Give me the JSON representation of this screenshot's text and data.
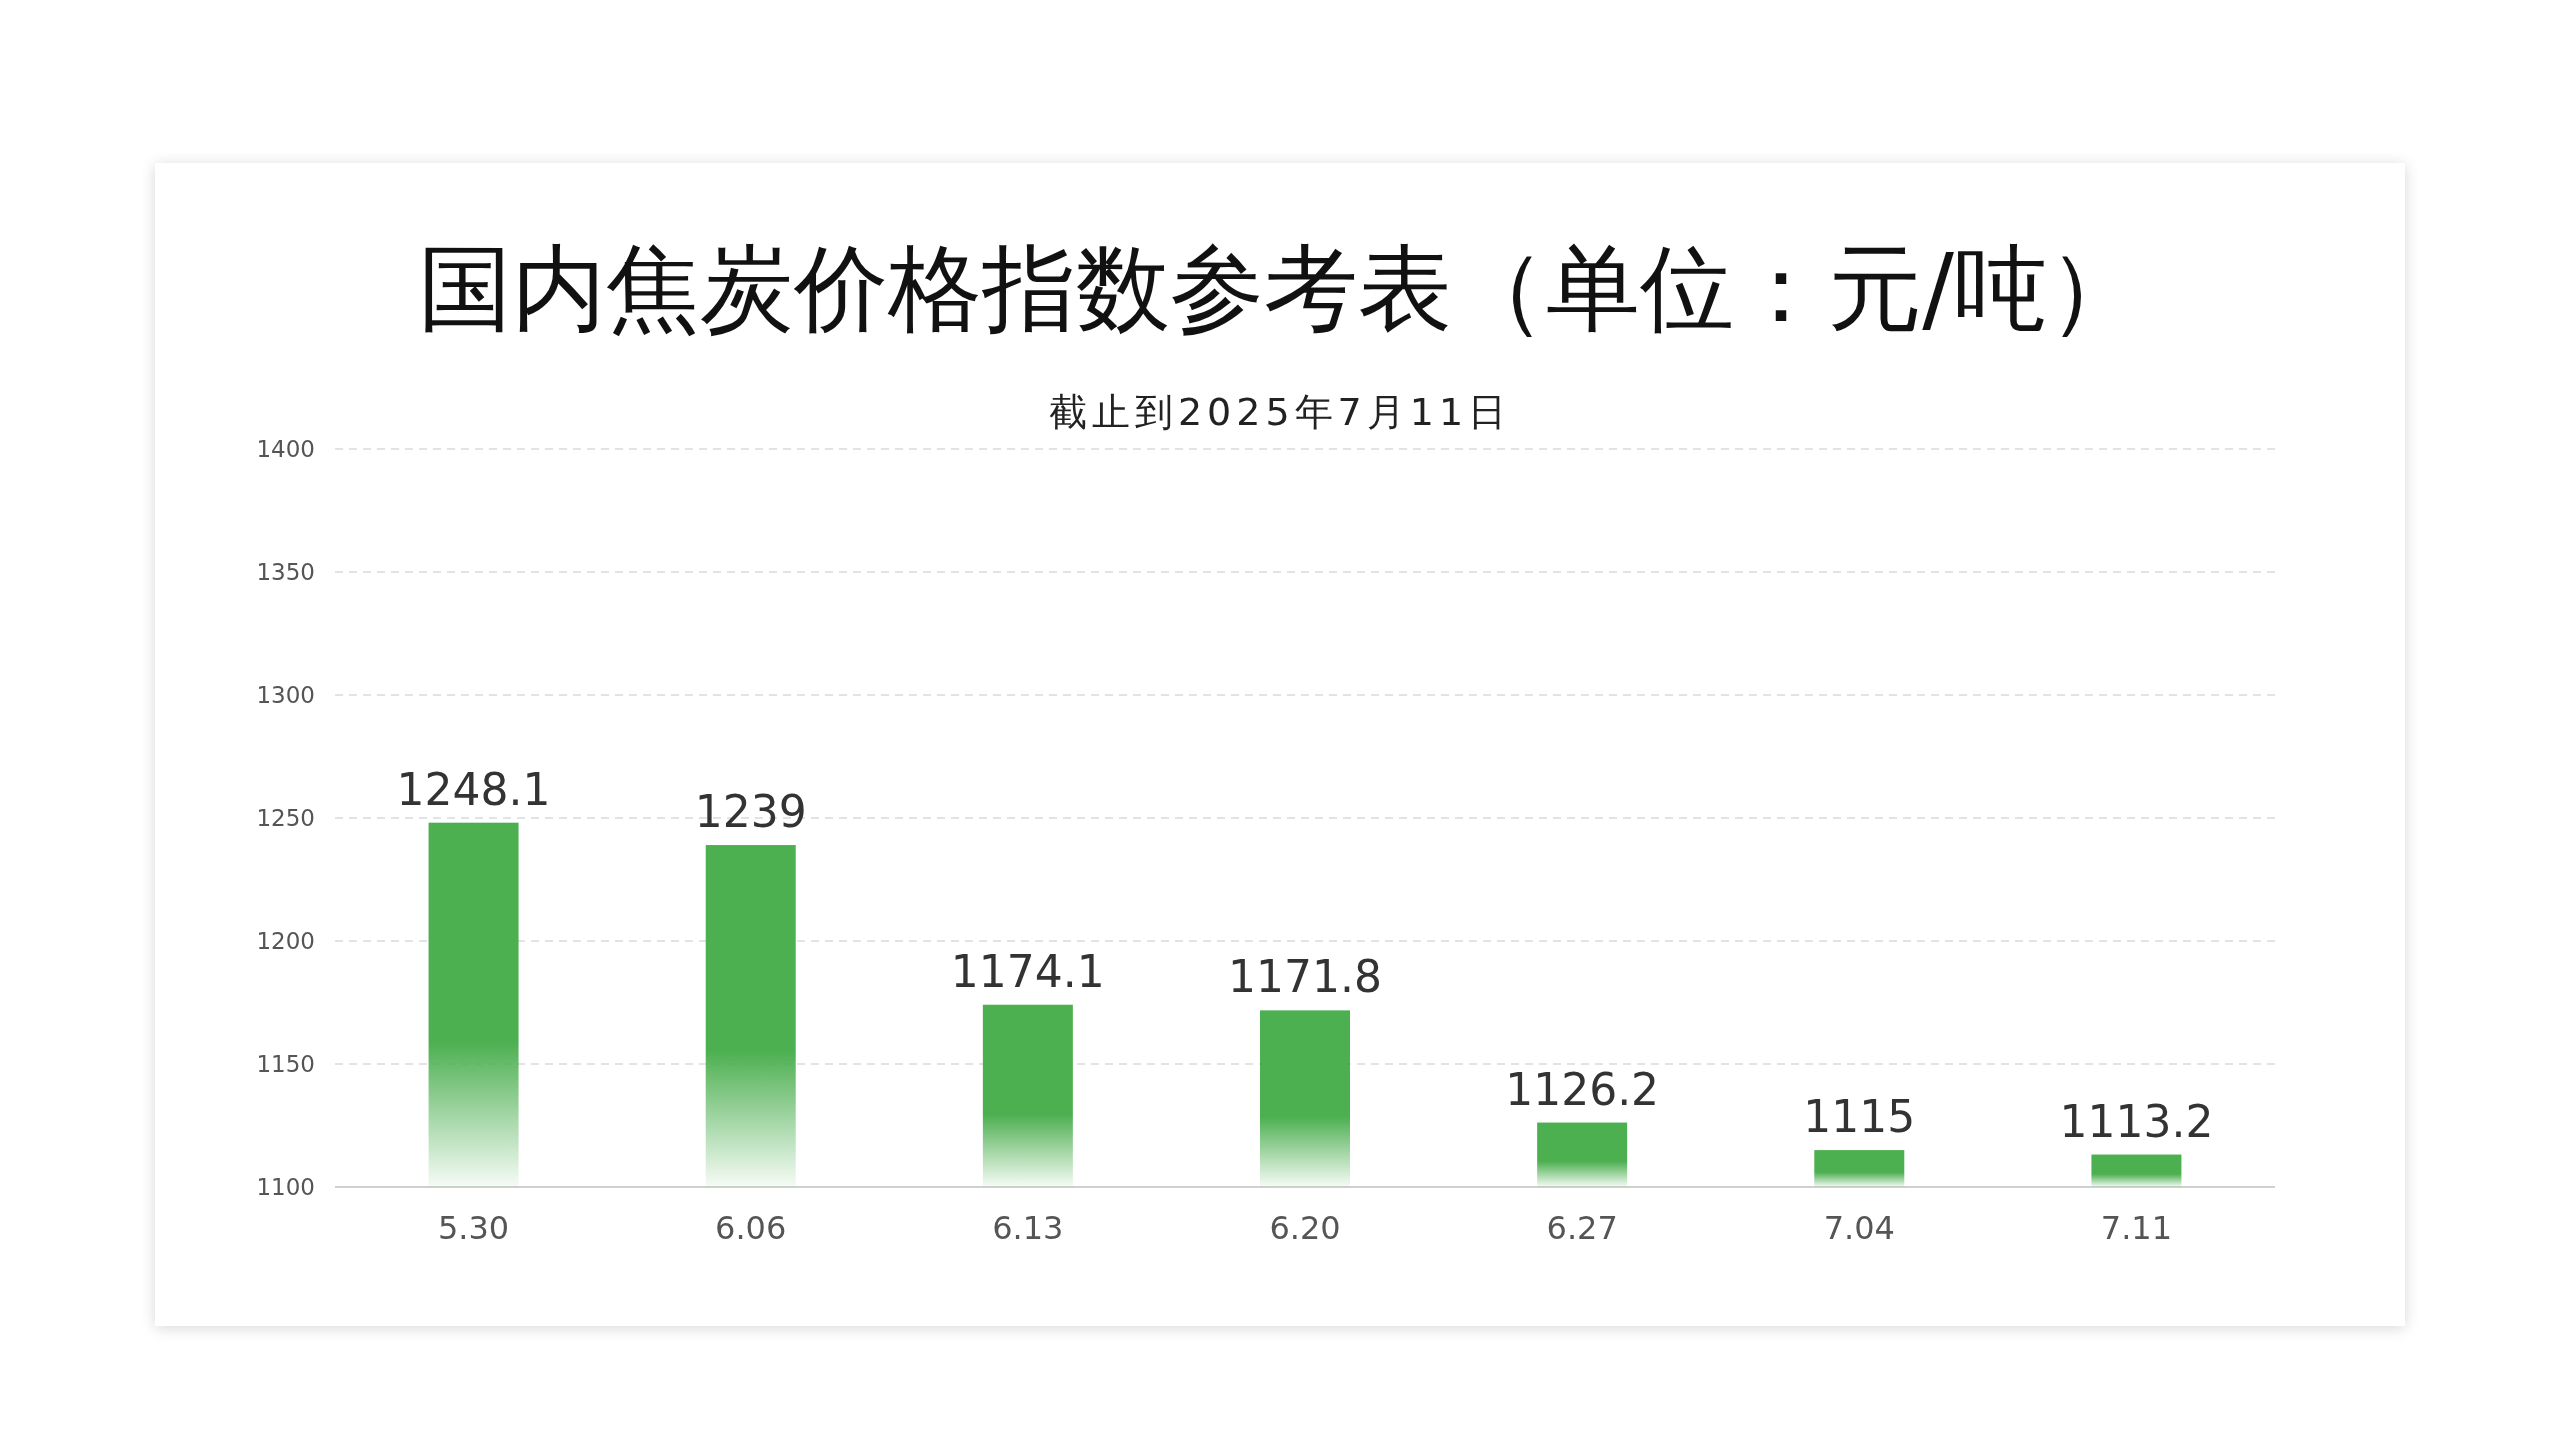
{
  "title": "国内焦炭价格指数参考表（单位：元/吨）",
  "subtitle": "截止到2025年7月11日",
  "chart_data": {
    "type": "bar",
    "categories": [
      "5.30",
      "6.06",
      "6.13",
      "6.20",
      "6.27",
      "7.04",
      "7.11"
    ],
    "series": [
      {
        "color": "#4caf50",
        "values": [
          1248.1,
          1239,
          1174.1,
          1171.8,
          1126.2,
          1115,
          1113.2
        ]
      }
    ],
    "ylim": [
      1100,
      1400
    ],
    "yticks": [
      1100,
      1150,
      1200,
      1250,
      1300,
      1350,
      1400
    ],
    "data_labels": true,
    "grid": true
  }
}
